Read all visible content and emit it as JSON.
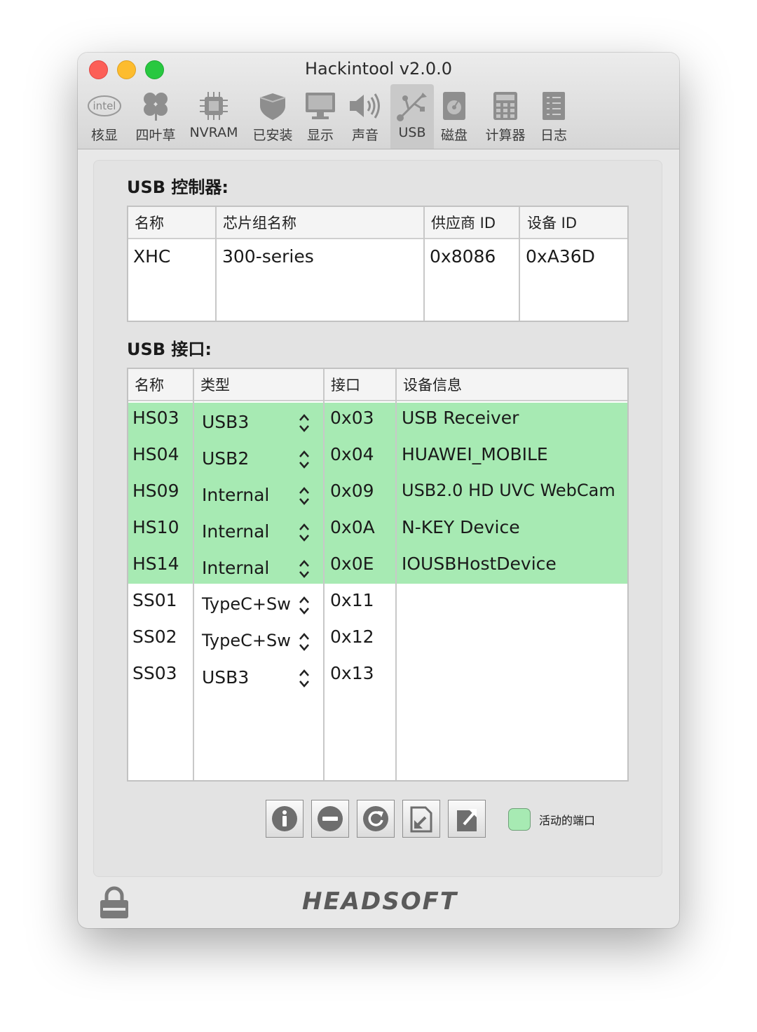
{
  "window": {
    "title": "Hackintool v2.0.0"
  },
  "toolbar": {
    "items": [
      {
        "label": "核显",
        "icon": "intel-icon"
      },
      {
        "label": "四叶草",
        "icon": "clover-icon"
      },
      {
        "label": "NVRAM",
        "icon": "chip-icon"
      },
      {
        "label": "已安装",
        "icon": "shield-icon"
      },
      {
        "label": "显示",
        "icon": "monitor-icon"
      },
      {
        "label": "声音",
        "icon": "speaker-icon"
      },
      {
        "label": "USB",
        "icon": "usb-icon",
        "active": true
      },
      {
        "label": "磁盘",
        "icon": "disk-icon"
      },
      {
        "label": "计算器",
        "icon": "calculator-icon"
      },
      {
        "label": "日志",
        "icon": "log-icon"
      }
    ]
  },
  "controllers": {
    "title": "USB 控制器:",
    "headers": [
      "名称",
      "芯片组名称",
      "供应商 ID",
      "设备 ID"
    ],
    "rows": [
      {
        "name": "XHC",
        "chipset": "300-series",
        "vendor_id": "0x8086",
        "device_id": "0xA36D"
      }
    ]
  },
  "ports": {
    "title": "USB 接口:",
    "headers": [
      "名称",
      "类型",
      "接口",
      "设备信息"
    ],
    "rows": [
      {
        "name": "HS03",
        "type": "USB3",
        "port": "0x03",
        "device": "USB Receiver",
        "active": true
      },
      {
        "name": "HS04",
        "type": "USB2",
        "port": "0x04",
        "device": "HUAWEI_MOBILE",
        "active": true
      },
      {
        "name": "HS09",
        "type": "Internal",
        "port": "0x09",
        "device": "USB2.0 HD UVC WebCam",
        "active": true
      },
      {
        "name": "HS10",
        "type": "Internal",
        "port": "0x0A",
        "device": "N-KEY Device",
        "active": true
      },
      {
        "name": "HS14",
        "type": "Internal",
        "port": "0x0E",
        "device": "IOUSBHostDevice",
        "active": true
      },
      {
        "name": "SS01",
        "type": "TypeC+Sw",
        "port": "0x11",
        "device": "",
        "active": false
      },
      {
        "name": "SS02",
        "type": "TypeC+Sw",
        "port": "0x12",
        "device": "",
        "active": false
      },
      {
        "name": "SS03",
        "type": "USB3",
        "port": "0x13",
        "device": "",
        "active": false
      }
    ]
  },
  "actions": {
    "buttons": [
      {
        "icon": "info-icon"
      },
      {
        "icon": "remove-icon"
      },
      {
        "icon": "refresh-icon"
      },
      {
        "icon": "import-icon"
      },
      {
        "icon": "export-icon"
      }
    ]
  },
  "legend": {
    "label": "活动的端口",
    "color": "#a7eab3"
  },
  "footer": {
    "brand": "HEADSOFT"
  },
  "colors": {
    "active_row": "#a7eab3"
  }
}
